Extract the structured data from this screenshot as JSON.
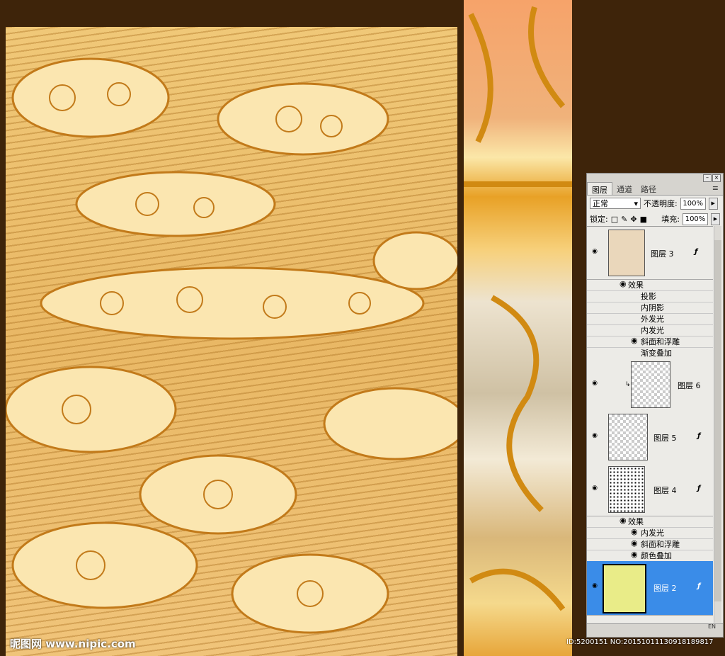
{
  "panel": {
    "tabs": [
      {
        "label": "图层"
      },
      {
        "label": "通道"
      },
      {
        "label": "路径"
      }
    ],
    "blend_mode": "正常",
    "opacity_label": "不透明度:",
    "opacity_value": "100%",
    "lock_label": "锁定:",
    "fill_label": "填充:",
    "fill_value": "100%",
    "effects_label": "效果",
    "layers": [
      {
        "name": "图层 3",
        "effects": [
          "投影",
          "内阴影",
          "外发光",
          "内发光",
          "斜面和浮雕",
          "渐变叠加"
        ]
      },
      {
        "name": "图层 6"
      },
      {
        "name": "图层 5"
      },
      {
        "name": "图层 4",
        "effects": [
          "内发光",
          "斜面和浮雕",
          "颜色叠加"
        ]
      },
      {
        "name": "图层 2"
      }
    ],
    "input_indicator": "EN"
  },
  "watermarks": {
    "left": "昵图网 www.nipic.com",
    "right": "ID:5200151 NO:20151011130918189817"
  },
  "colors": {
    "background": "#3e240a",
    "selection": "#3a8ce8",
    "gold": "#e9b865"
  }
}
